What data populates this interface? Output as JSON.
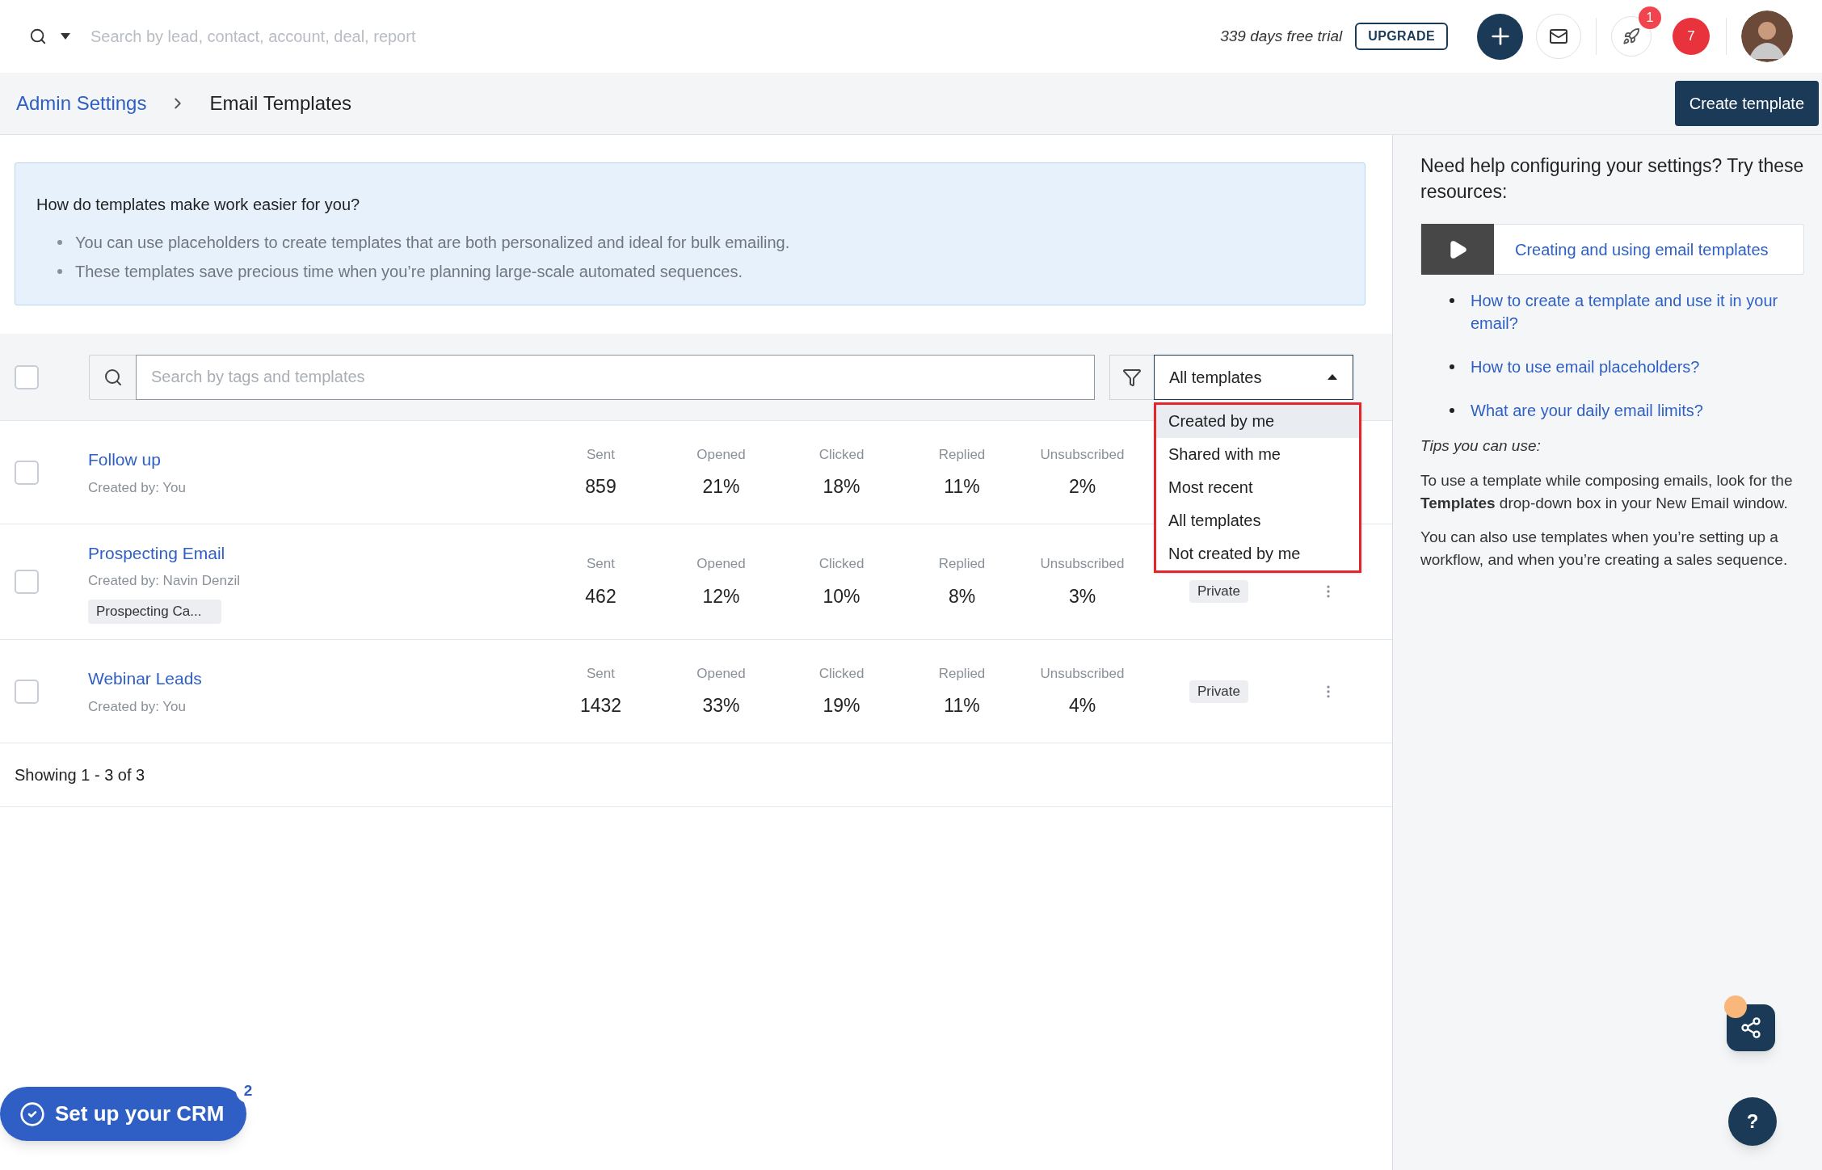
{
  "top_bar": {
    "search_placeholder": "Search by lead, contact, account, deal, report",
    "trial_text": "339 days free trial",
    "upgrade_button": "UPGRADE",
    "notification_badge": "1",
    "alerts_count": "7"
  },
  "breadcrumb": [
    {
      "label": "Admin Settings",
      "kind": "link"
    },
    {
      "label": "Email Templates",
      "kind": "current"
    }
  ],
  "create_button": "Create template",
  "info_box": {
    "title": "How do templates make work easier for you?",
    "bullets": [
      "You can use placeholders to create templates that are both personalized and ideal for bulk emailing.",
      "These templates save precious time when you’re planning large-scale automated sequences."
    ]
  },
  "toolbar": {
    "select_all_checked": false,
    "search_placeholder": "Search by tags and templates",
    "filter_value": "All templates",
    "filter_expanded": true,
    "filter_options": [
      {
        "label": "Created by me",
        "selected": true
      },
      {
        "label": "Shared with me",
        "selected": false
      },
      {
        "label": "Most recent",
        "selected": false
      },
      {
        "label": "All templates",
        "selected": false
      },
      {
        "label": "Not created by me",
        "selected": false
      }
    ]
  },
  "templates": [
    {
      "name": "Follow up",
      "created_by": "Created by: You",
      "checked": false,
      "more_menu": false,
      "stats": [
        {
          "label": "Sent",
          "value": "859"
        },
        {
          "label": "Opened",
          "value": "21%"
        },
        {
          "label": "Clicked",
          "value": "18%"
        },
        {
          "label": "Replied",
          "value": "11%"
        },
        {
          "label": "Unsubscribed",
          "value": "2%"
        }
      ]
    },
    {
      "name": "Prospecting Email",
      "created_by": "Created by: Navin Denzil",
      "tag": "Prospecting Ca...",
      "checked": false,
      "status": "Private",
      "more_menu": true,
      "stats": [
        {
          "label": "Sent",
          "value": "462"
        },
        {
          "label": "Opened",
          "value": "12%"
        },
        {
          "label": "Clicked",
          "value": "10%"
        },
        {
          "label": "Replied",
          "value": "8%"
        },
        {
          "label": "Unsubscribed",
          "value": "3%"
        }
      ]
    },
    {
      "name": "Webinar Leads",
      "created_by": "Created by: You",
      "checked": false,
      "status": "Private",
      "more_menu": true,
      "stats": [
        {
          "label": "Sent",
          "value": "1432"
        },
        {
          "label": "Opened",
          "value": "33%"
        },
        {
          "label": "Clicked",
          "value": "19%"
        },
        {
          "label": "Replied",
          "value": "11%"
        },
        {
          "label": "Unsubscribed",
          "value": "4%"
        }
      ]
    }
  ],
  "footer": "Showing 1 - 3 of 3",
  "help_panel": {
    "title": "Need help configuring your settings? Try these resources:",
    "video_link": "Creating and using email templates",
    "links": [
      "How to create a template and use it in your email?",
      "How to use email placeholders?",
      "What are your daily email limits?"
    ],
    "tips_title": "Tips you can use:",
    "tips": [
      "To use a template while composing emails, look for the **Templates** drop-down box in your New Email window.",
      "You can also use templates when you’re setting up a workflow, and when you’re creating a sales sequence."
    ]
  },
  "setup_button": {
    "label": "Set up your CRM",
    "badge": "2"
  },
  "help_button": "?"
}
